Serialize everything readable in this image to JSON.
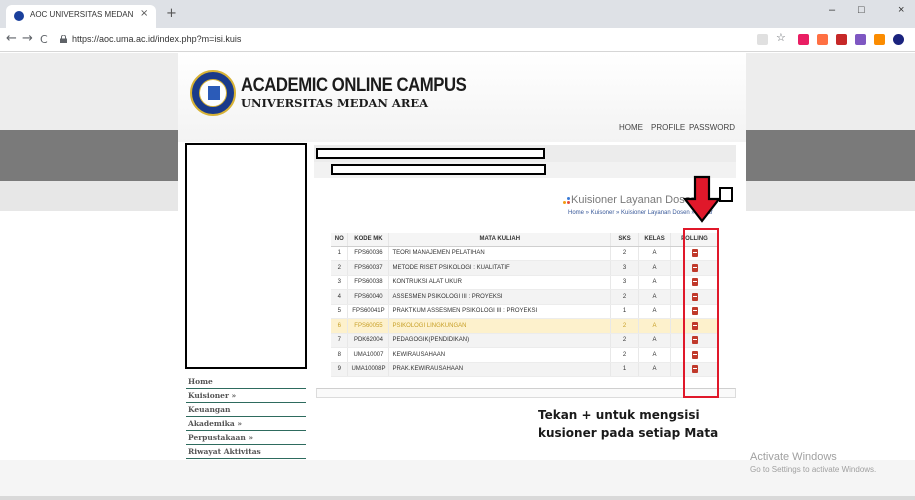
{
  "browser": {
    "tab_title": "AOC UNIVERSITAS MEDAN AREA",
    "tab_close": "×",
    "new_tab": "+",
    "url": "https://aoc.uma.ac.id/index.php?m=isi.kuis",
    "window_controls": {
      "minimize": "–",
      "maximize": "□",
      "close": "×"
    },
    "nav": {
      "back": "←",
      "forward": "→",
      "reload": "C"
    },
    "extension_colors": [
      "#e91e63",
      "#ff7043",
      "#c62828",
      "#7e57c2",
      "#fb8c00",
      "#43a047",
      "#1a237e"
    ]
  },
  "header": {
    "title": "ACADEMIC ONLINE CAMPUS",
    "subtitle": "UNIVERSITAS MEDAN AREA",
    "nav": [
      "HOME",
      "PROFILE",
      "PASSWORD"
    ]
  },
  "content": {
    "heading": "Kuisioner Layanan Dosen",
    "breadcrumb": "Home » Kuisoner » Kuisioner Layanan Dosen » Daftar"
  },
  "table": {
    "columns": [
      "NO",
      "KODE MK",
      "MATA KULIAH",
      "SKS",
      "KELAS",
      "POLLING"
    ],
    "rows": [
      [
        "1",
        "FPS60036",
        "TEORI MANAJEMEN PELATIHAN",
        "2",
        "A"
      ],
      [
        "2",
        "FPS60037",
        "METODE RISET PSIKOLOGI : KUALITATIF",
        "3",
        "A"
      ],
      [
        "3",
        "FPS60038",
        "KONTRUKSI ALAT UKUR",
        "3",
        "A"
      ],
      [
        "4",
        "FPS60040",
        "ASSESMEN PSIKOLOGI III : PROYEKSI",
        "2",
        "A"
      ],
      [
        "5",
        "FPS60041P",
        "PRAKTKUM ASSESMEN PSIKOLOGI III : PROYEKSI",
        "1",
        "A"
      ],
      [
        "6",
        "FPS60055",
        "PSIKOLOGI LINGKUNGAN",
        "2",
        "A"
      ],
      [
        "7",
        "PDK62004",
        "PEDAGOGIK(PENDIDIKAN)",
        "2",
        "A"
      ],
      [
        "8",
        "UMA10007",
        "KEWIRAUSAHAAN",
        "2",
        "A"
      ],
      [
        "9",
        "UMA10008P",
        "PRAK.KEWIRAUSAHAAN",
        "1",
        "A"
      ]
    ],
    "highlighted_row": "6"
  },
  "annotation": {
    "line1": "Tekan + untuk mengsisi",
    "line2": "kusioner pada setiap Mata",
    "color": "#e0182a"
  },
  "sidebar": {
    "items": [
      "Home",
      "Kuisioner »",
      "Keuangan",
      "Akademika »",
      "Perpustakaan »",
      "Riwayat Aktivitas"
    ]
  },
  "watermark": {
    "title": "Activate Windows",
    "subtitle": "Go to Settings to activate Windows."
  }
}
